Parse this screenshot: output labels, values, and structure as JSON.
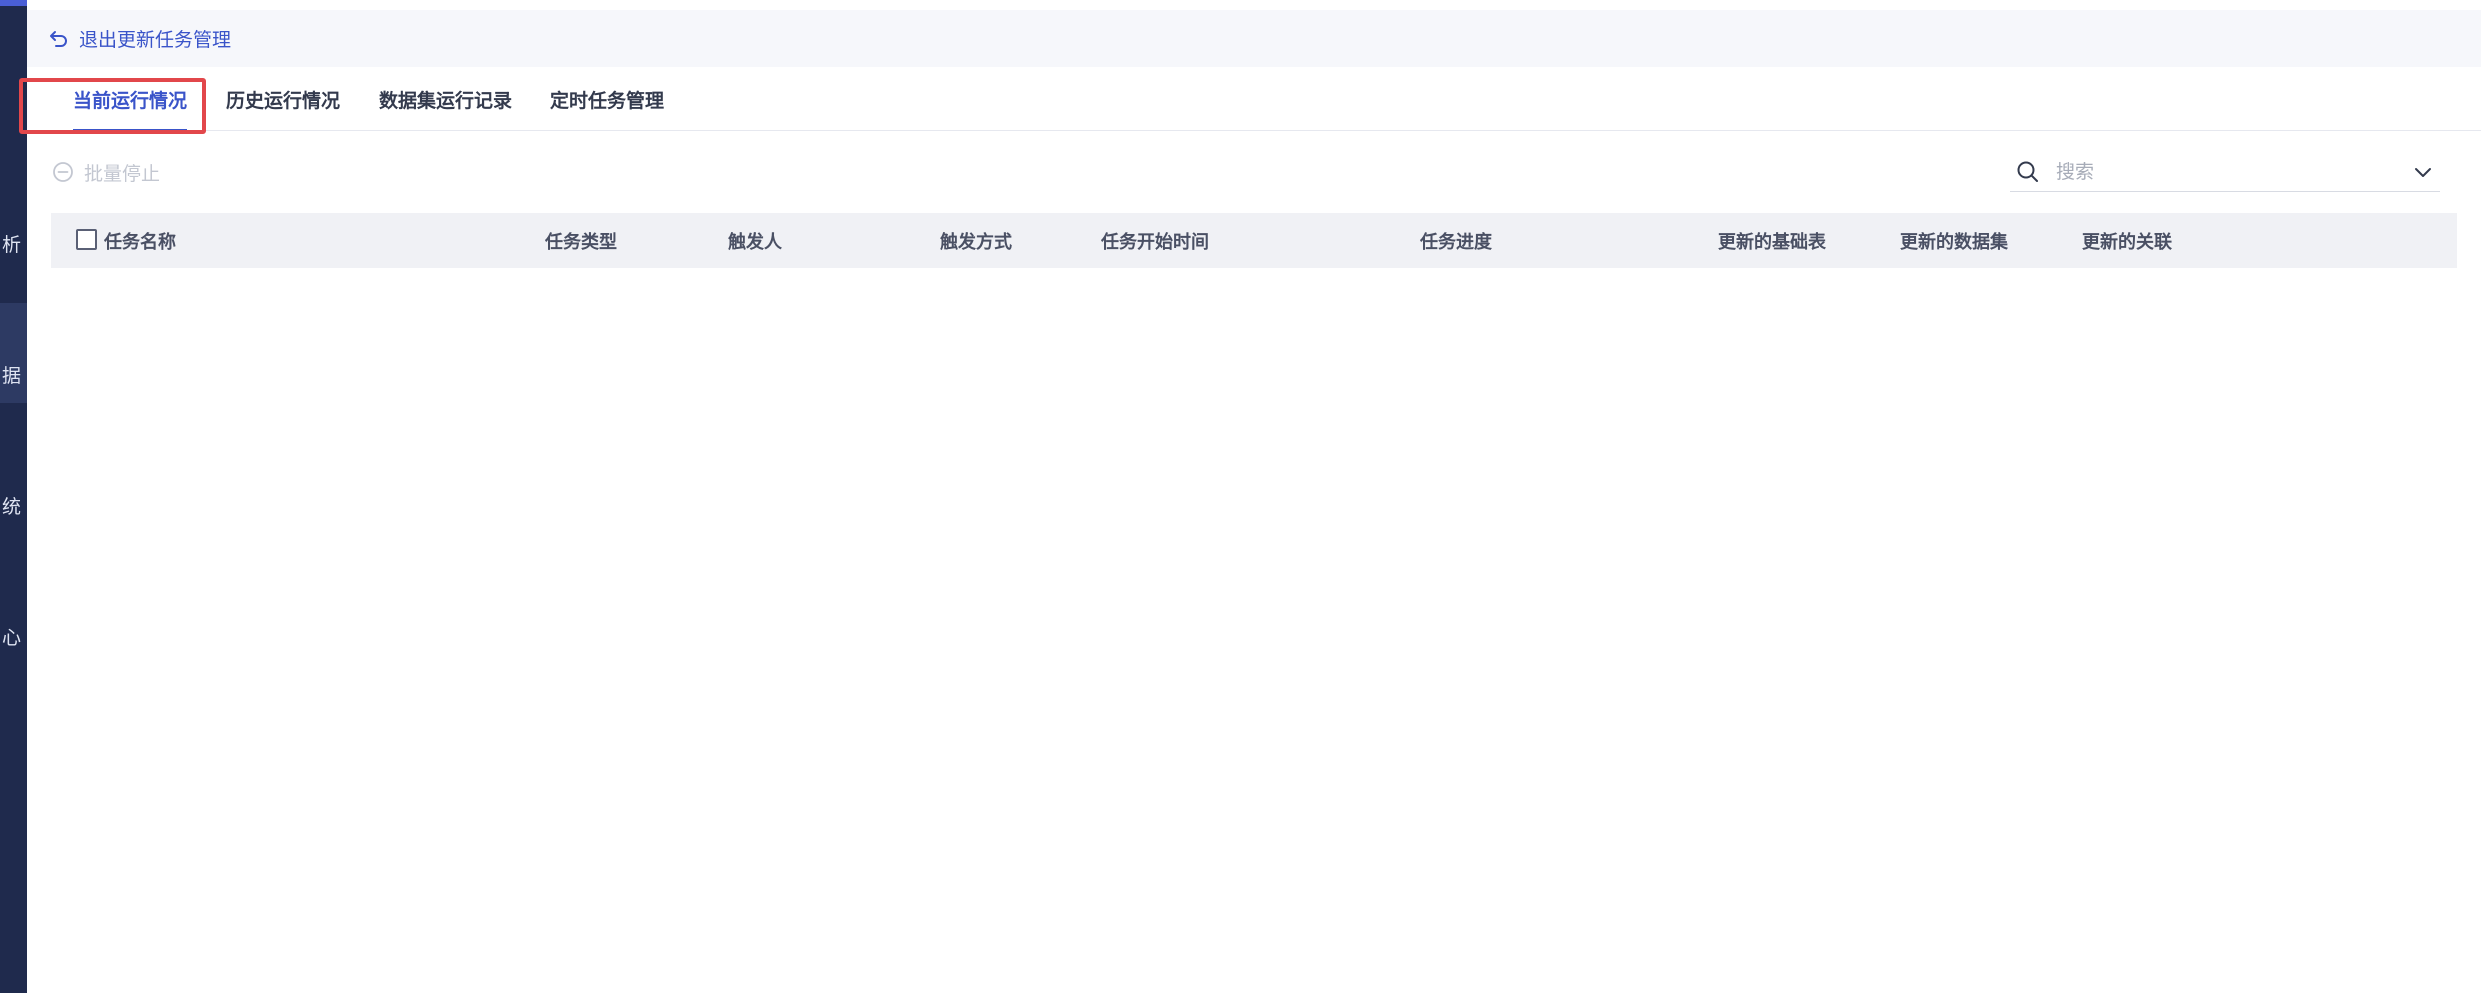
{
  "sidebar": {
    "items": [
      {
        "label": "分析",
        "visible_char": "析"
      },
      {
        "label": "数据",
        "visible_char": "据"
      },
      {
        "label": "系统",
        "visible_char": "统"
      },
      {
        "label": "中心",
        "visible_char": "心"
      }
    ],
    "active_index": 1
  },
  "header": {
    "exit_label": "退出更新任务管理"
  },
  "tabs": [
    {
      "label": "当前运行情况"
    },
    {
      "label": "历史运行情况"
    },
    {
      "label": "数据集运行记录"
    },
    {
      "label": "定时任务管理"
    }
  ],
  "active_tab": 0,
  "toolbar": {
    "batch_stop_label": "批量停止"
  },
  "search": {
    "placeholder": "搜索",
    "value": ""
  },
  "table": {
    "columns": [
      "任务名称",
      "任务类型",
      "触发人",
      "触发方式",
      "任务开始时间",
      "任务进度",
      "更新的基础表",
      "更新的数据集",
      "更新的关联"
    ],
    "rows": []
  },
  "colors": {
    "sidebar_bg": "#1f2a4d",
    "accent": "#3a54c9",
    "highlight": "#e2474b",
    "header_row_bg": "#f0f1f5"
  }
}
